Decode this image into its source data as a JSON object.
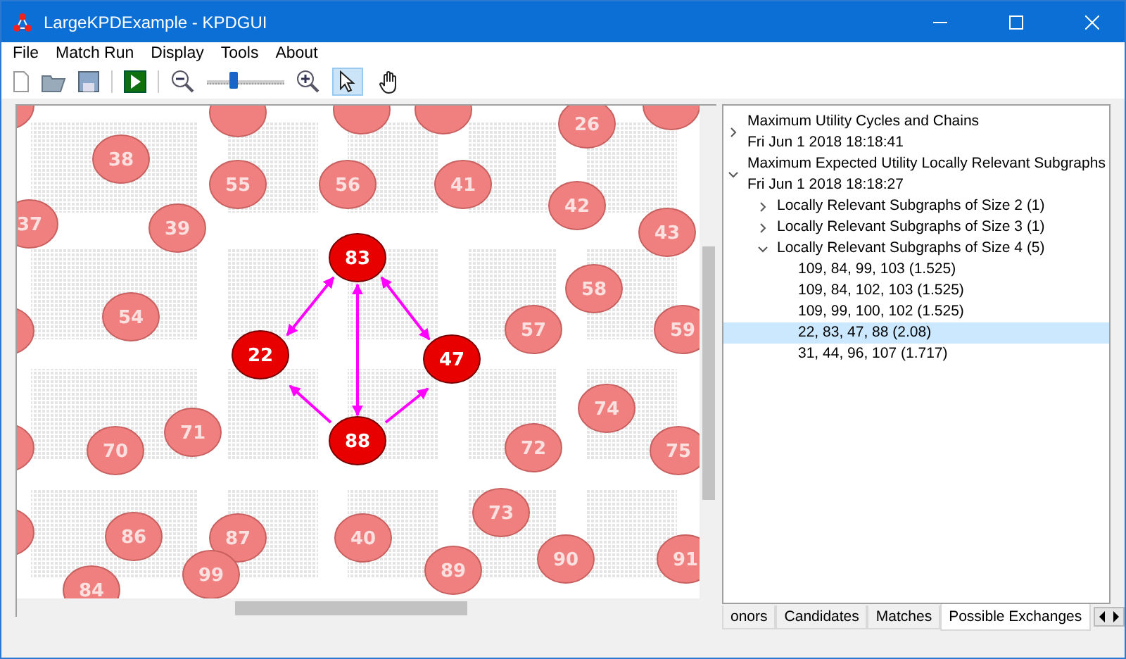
{
  "window": {
    "title": "LargeKPDExample - KPDGUI"
  },
  "menu": [
    "File",
    "Match Run",
    "Display",
    "Tools",
    "About"
  ],
  "toolbar": {
    "zoom_slider": {
      "level": 0.35
    },
    "pointer_tool": {
      "selected": true
    },
    "pan_tool": {
      "selected": false
    }
  },
  "graph": {
    "nodes": [
      {
        "label": "26",
        "highlighted": false
      },
      {
        "label": "38",
        "highlighted": false
      },
      {
        "label": "55",
        "highlighted": false
      },
      {
        "label": "56",
        "highlighted": false
      },
      {
        "label": "41",
        "highlighted": false
      },
      {
        "label": "42",
        "highlighted": false
      },
      {
        "label": "37",
        "highlighted": false
      },
      {
        "label": "39",
        "highlighted": false
      },
      {
        "label": "43",
        "highlighted": false
      },
      {
        "label": "83",
        "highlighted": true
      },
      {
        "label": "58",
        "highlighted": false
      },
      {
        "label": "54",
        "highlighted": false
      },
      {
        "label": "57",
        "highlighted": false
      },
      {
        "label": "59",
        "highlighted": false
      },
      {
        "label": "22",
        "highlighted": true
      },
      {
        "label": "47",
        "highlighted": true
      },
      {
        "label": "74",
        "highlighted": false
      },
      {
        "label": "71",
        "highlighted": false
      },
      {
        "label": "70",
        "highlighted": false
      },
      {
        "label": "88",
        "highlighted": true
      },
      {
        "label": "72",
        "highlighted": false
      },
      {
        "label": "75",
        "highlighted": false
      },
      {
        "label": "73",
        "highlighted": false
      },
      {
        "label": "86",
        "highlighted": false
      },
      {
        "label": "87",
        "highlighted": false
      },
      {
        "label": "40",
        "highlighted": false
      },
      {
        "label": "84",
        "highlighted": false
      },
      {
        "label": "99",
        "highlighted": false
      },
      {
        "label": "89",
        "highlighted": false
      },
      {
        "label": "90",
        "highlighted": false
      },
      {
        "label": "91",
        "highlighted": false
      }
    ]
  },
  "tree": [
    {
      "label": "Maximum Utility Cycles and Chains",
      "date": "Fri Jun 1 2018 18:18:41",
      "expanded": false,
      "selected": false
    },
    {
      "label": "Maximum Expected Utility Locally Relevant Subgraphs",
      "date": "Fri Jun 1 2018 18:18:27",
      "expanded": true,
      "selected": false,
      "children": [
        {
          "label": "Locally Relevant Subgraphs of Size 2 (1)",
          "expanded": false,
          "selected": false
        },
        {
          "label": "Locally Relevant Subgraphs of Size 3 (1)",
          "expanded": false,
          "selected": false
        },
        {
          "label": "Locally Relevant Subgraphs of Size 4 (5)",
          "expanded": true,
          "selected": false,
          "children": [
            {
              "label": "109, 84, 99, 103 (1.525)",
              "selected": false
            },
            {
              "label": "109, 84, 102, 103 (1.525)",
              "selected": false
            },
            {
              "label": "109, 99, 100, 102 (1.525)",
              "selected": false
            },
            {
              "label": "22, 83, 47, 88 (2.08)",
              "selected": true
            },
            {
              "label": "31, 44, 96, 107 (1.717)",
              "selected": false
            }
          ]
        }
      ]
    }
  ],
  "tabs": [
    {
      "label": "onors",
      "selected": false
    },
    {
      "label": "Candidates",
      "selected": false
    },
    {
      "label": "Matches",
      "selected": false
    },
    {
      "label": "Possible Exchanges",
      "selected": true
    }
  ]
}
